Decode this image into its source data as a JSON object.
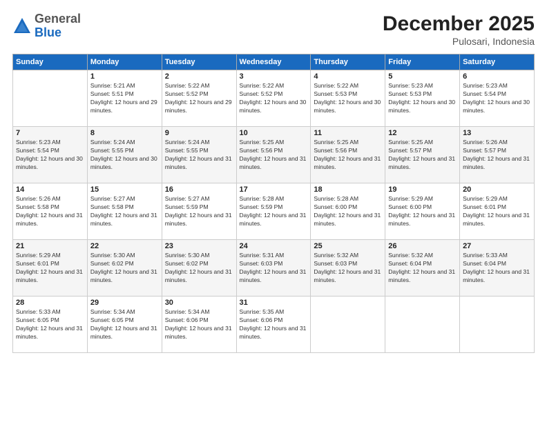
{
  "logo": {
    "general": "General",
    "blue": "Blue"
  },
  "header": {
    "month": "December 2025",
    "location": "Pulosari, Indonesia"
  },
  "days_of_week": [
    "Sunday",
    "Monday",
    "Tuesday",
    "Wednesday",
    "Thursday",
    "Friday",
    "Saturday"
  ],
  "weeks": [
    [
      {
        "day": "",
        "sunrise": "",
        "sunset": "",
        "daylight": ""
      },
      {
        "day": "1",
        "sunrise": "Sunrise: 5:21 AM",
        "sunset": "Sunset: 5:51 PM",
        "daylight": "Daylight: 12 hours and 29 minutes."
      },
      {
        "day": "2",
        "sunrise": "Sunrise: 5:22 AM",
        "sunset": "Sunset: 5:52 PM",
        "daylight": "Daylight: 12 hours and 29 minutes."
      },
      {
        "day": "3",
        "sunrise": "Sunrise: 5:22 AM",
        "sunset": "Sunset: 5:52 PM",
        "daylight": "Daylight: 12 hours and 30 minutes."
      },
      {
        "day": "4",
        "sunrise": "Sunrise: 5:22 AM",
        "sunset": "Sunset: 5:53 PM",
        "daylight": "Daylight: 12 hours and 30 minutes."
      },
      {
        "day": "5",
        "sunrise": "Sunrise: 5:23 AM",
        "sunset": "Sunset: 5:53 PM",
        "daylight": "Daylight: 12 hours and 30 minutes."
      },
      {
        "day": "6",
        "sunrise": "Sunrise: 5:23 AM",
        "sunset": "Sunset: 5:54 PM",
        "daylight": "Daylight: 12 hours and 30 minutes."
      }
    ],
    [
      {
        "day": "7",
        "sunrise": "Sunrise: 5:23 AM",
        "sunset": "Sunset: 5:54 PM",
        "daylight": "Daylight: 12 hours and 30 minutes."
      },
      {
        "day": "8",
        "sunrise": "Sunrise: 5:24 AM",
        "sunset": "Sunset: 5:55 PM",
        "daylight": "Daylight: 12 hours and 30 minutes."
      },
      {
        "day": "9",
        "sunrise": "Sunrise: 5:24 AM",
        "sunset": "Sunset: 5:55 PM",
        "daylight": "Daylight: 12 hours and 31 minutes."
      },
      {
        "day": "10",
        "sunrise": "Sunrise: 5:25 AM",
        "sunset": "Sunset: 5:56 PM",
        "daylight": "Daylight: 12 hours and 31 minutes."
      },
      {
        "day": "11",
        "sunrise": "Sunrise: 5:25 AM",
        "sunset": "Sunset: 5:56 PM",
        "daylight": "Daylight: 12 hours and 31 minutes."
      },
      {
        "day": "12",
        "sunrise": "Sunrise: 5:25 AM",
        "sunset": "Sunset: 5:57 PM",
        "daylight": "Daylight: 12 hours and 31 minutes."
      },
      {
        "day": "13",
        "sunrise": "Sunrise: 5:26 AM",
        "sunset": "Sunset: 5:57 PM",
        "daylight": "Daylight: 12 hours and 31 minutes."
      }
    ],
    [
      {
        "day": "14",
        "sunrise": "Sunrise: 5:26 AM",
        "sunset": "Sunset: 5:58 PM",
        "daylight": "Daylight: 12 hours and 31 minutes."
      },
      {
        "day": "15",
        "sunrise": "Sunrise: 5:27 AM",
        "sunset": "Sunset: 5:58 PM",
        "daylight": "Daylight: 12 hours and 31 minutes."
      },
      {
        "day": "16",
        "sunrise": "Sunrise: 5:27 AM",
        "sunset": "Sunset: 5:59 PM",
        "daylight": "Daylight: 12 hours and 31 minutes."
      },
      {
        "day": "17",
        "sunrise": "Sunrise: 5:28 AM",
        "sunset": "Sunset: 5:59 PM",
        "daylight": "Daylight: 12 hours and 31 minutes."
      },
      {
        "day": "18",
        "sunrise": "Sunrise: 5:28 AM",
        "sunset": "Sunset: 6:00 PM",
        "daylight": "Daylight: 12 hours and 31 minutes."
      },
      {
        "day": "19",
        "sunrise": "Sunrise: 5:29 AM",
        "sunset": "Sunset: 6:00 PM",
        "daylight": "Daylight: 12 hours and 31 minutes."
      },
      {
        "day": "20",
        "sunrise": "Sunrise: 5:29 AM",
        "sunset": "Sunset: 6:01 PM",
        "daylight": "Daylight: 12 hours and 31 minutes."
      }
    ],
    [
      {
        "day": "21",
        "sunrise": "Sunrise: 5:29 AM",
        "sunset": "Sunset: 6:01 PM",
        "daylight": "Daylight: 12 hours and 31 minutes."
      },
      {
        "day": "22",
        "sunrise": "Sunrise: 5:30 AM",
        "sunset": "Sunset: 6:02 PM",
        "daylight": "Daylight: 12 hours and 31 minutes."
      },
      {
        "day": "23",
        "sunrise": "Sunrise: 5:30 AM",
        "sunset": "Sunset: 6:02 PM",
        "daylight": "Daylight: 12 hours and 31 minutes."
      },
      {
        "day": "24",
        "sunrise": "Sunrise: 5:31 AM",
        "sunset": "Sunset: 6:03 PM",
        "daylight": "Daylight: 12 hours and 31 minutes."
      },
      {
        "day": "25",
        "sunrise": "Sunrise: 5:32 AM",
        "sunset": "Sunset: 6:03 PM",
        "daylight": "Daylight: 12 hours and 31 minutes."
      },
      {
        "day": "26",
        "sunrise": "Sunrise: 5:32 AM",
        "sunset": "Sunset: 6:04 PM",
        "daylight": "Daylight: 12 hours and 31 minutes."
      },
      {
        "day": "27",
        "sunrise": "Sunrise: 5:33 AM",
        "sunset": "Sunset: 6:04 PM",
        "daylight": "Daylight: 12 hours and 31 minutes."
      }
    ],
    [
      {
        "day": "28",
        "sunrise": "Sunrise: 5:33 AM",
        "sunset": "Sunset: 6:05 PM",
        "daylight": "Daylight: 12 hours and 31 minutes."
      },
      {
        "day": "29",
        "sunrise": "Sunrise: 5:34 AM",
        "sunset": "Sunset: 6:05 PM",
        "daylight": "Daylight: 12 hours and 31 minutes."
      },
      {
        "day": "30",
        "sunrise": "Sunrise: 5:34 AM",
        "sunset": "Sunset: 6:06 PM",
        "daylight": "Daylight: 12 hours and 31 minutes."
      },
      {
        "day": "31",
        "sunrise": "Sunrise: 5:35 AM",
        "sunset": "Sunset: 6:06 PM",
        "daylight": "Daylight: 12 hours and 31 minutes."
      },
      {
        "day": "",
        "sunrise": "",
        "sunset": "",
        "daylight": ""
      },
      {
        "day": "",
        "sunrise": "",
        "sunset": "",
        "daylight": ""
      },
      {
        "day": "",
        "sunrise": "",
        "sunset": "",
        "daylight": ""
      }
    ]
  ]
}
